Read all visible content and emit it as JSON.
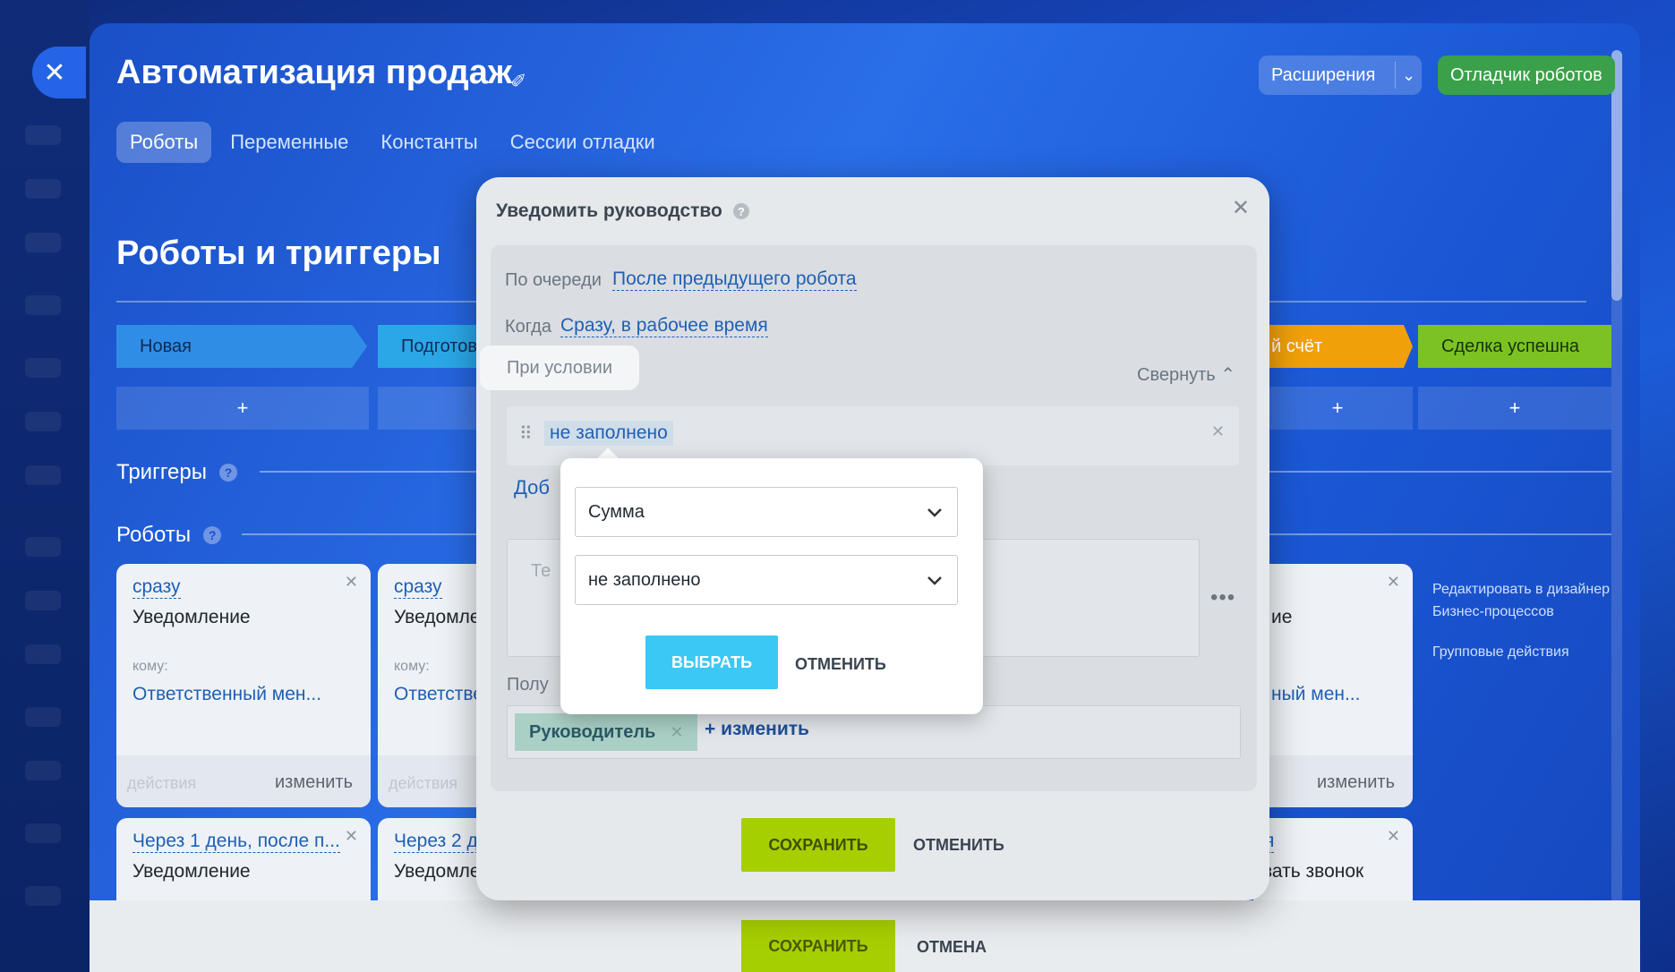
{
  "header": {
    "title": "Автоматизация продаж",
    "extensions_label": "Расширения",
    "debugger_label": "Отладчик роботов"
  },
  "tabs": [
    {
      "label": "Роботы",
      "active": true
    },
    {
      "label": "Переменные",
      "active": false
    },
    {
      "label": "Константы",
      "active": false
    },
    {
      "label": "Сессии отладки",
      "active": false
    }
  ],
  "section_title": "Роботы и триггеры",
  "stages": [
    "Новая",
    "Подготов",
    "й счёт",
    "Сделка успешна"
  ],
  "stage_colors": [
    "#2f8de6",
    "#2aa7e6",
    "#f0a10a",
    "#7cc223"
  ],
  "add_symbol": "+",
  "triggers_label": "Триггеры",
  "robots_label": "Роботы",
  "cards": [
    {
      "when": "сразу",
      "type": "Уведомление",
      "to_label": "кому:",
      "to": "Ответственный мен...",
      "actions": "действия",
      "edit": "изменить"
    },
    {
      "when": "сразу",
      "type": "Уведомле",
      "to_label": "кому:",
      "to": "Ответстве",
      "actions": "действия",
      "edit": ""
    },
    {
      "when": "",
      "type": "ие",
      "to_label": "",
      "to": "ный мен...",
      "actions": "",
      "edit": "изменить"
    },
    {
      "when": "Через 1 день, после п...",
      "type": "Уведомление"
    },
    {
      "when": "Через 2 д",
      "type": "Уведомле"
    },
    {
      "when": "я",
      "type": "вать звонок"
    }
  ],
  "side_links": {
    "designer": "Редактировать в дизайнер Бизнес-процессов",
    "group": "Групповые действия"
  },
  "modal": {
    "title": "Уведомить руководство",
    "queue_label": "По очереди",
    "queue_value": "После предыдущего робота",
    "when_label": "Когда",
    "when_value": "Сразу, в рабочее время",
    "condition_label": "При условии",
    "collapse_label": "Свернуть",
    "condition_chip": "не заполнено",
    "add_link": "Доб",
    "text_placeholder": "Те",
    "recipients_label": "Полу",
    "recipient_chip": "Руководитель",
    "change_link": "+ изменить",
    "save": "СОХРАНИТЬ",
    "cancel": "ОТМЕНИТЬ"
  },
  "popup": {
    "field_select": "Сумма",
    "operator_select": "не заполнено",
    "choose": "ВЫБРАТЬ",
    "cancel": "ОТМЕНИТЬ"
  },
  "footer": {
    "save": "СОХРАНИТЬ",
    "cancel": "ОТМЕНА"
  }
}
